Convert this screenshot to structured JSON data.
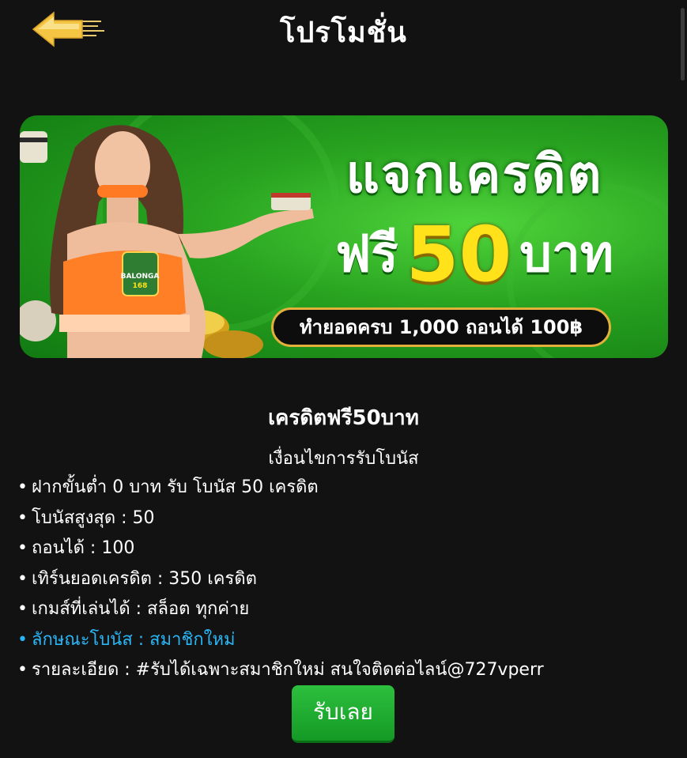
{
  "header": {
    "title": "โปรโมชั่น",
    "back_icon": "back-arrow-icon"
  },
  "banner": {
    "headline": "แจกเครดิต",
    "free_label": "ฟรี",
    "amount": "50",
    "unit": "บาท",
    "condition": "ทำยอดครบ 1,000 ถอนได้ 100฿",
    "logo_text_1": "BALONGA",
    "logo_text_2": "168",
    "colors": {
      "background": "#27a11f",
      "amount": "#ffe21a",
      "pill_border": "#e3b03b"
    }
  },
  "promotion": {
    "title": "เครดิตฟรี50บาท",
    "conditions_heading": "เงื่อนไขการรับโบนัส",
    "bullet": "•",
    "items": [
      "ฝากขั้นต่ำ 0 บาท รับ โบนัส 50 เครดิต",
      "โบนัสสูงสุด : 50",
      "ถอนได้ : 100",
      "เทิร์นยอดเครดิต : 350 เครดิต",
      "เกมส์ที่เล่นได้ : สล็อต ทุกค่าย",
      "ลักษณะโบนัส : สมาชิกใหม่",
      "รายละเอียด : #รับได้เฉพาะสมาชิกใหม่ สนใจติดต่อไลน์@727vperr"
    ],
    "highlight_color": "#29b6f6"
  },
  "actions": {
    "claim_label": "รับเลย",
    "claim_color": "#1faa2f"
  }
}
